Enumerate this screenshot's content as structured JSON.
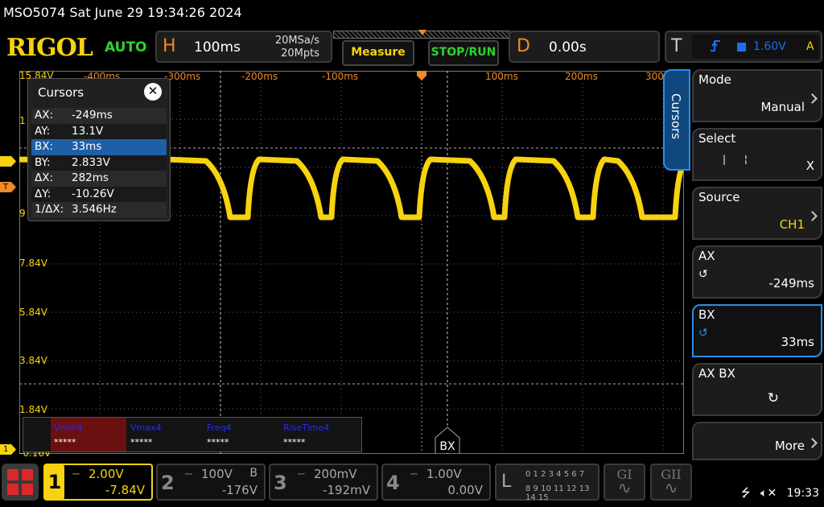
{
  "title_bar": {
    "text": "MSO5074  Sat June 29 19:34:26 2024"
  },
  "top": {
    "logo": "RIGOL",
    "trigger_status": "AUTO",
    "horizontal": {
      "letter": "H",
      "timebase": "100ms",
      "sample_rate": "20MSa/s",
      "memory_depth": "20Mpts"
    },
    "measure_label": "Measure",
    "stop_run_label": "STOP/RUN",
    "delay": {
      "letter": "D",
      "value": "0.00s"
    },
    "trigger": {
      "letter": "T",
      "level": "1.60V",
      "mode": "A",
      "edge_icon": "rising-edge-icon",
      "source_color": "#1e6ef0"
    }
  },
  "graticule": {
    "y_labels": [
      "15.84V",
      "1",
      "9",
      "7.84V",
      "5.84V",
      "3.84V",
      "1.84V",
      "-0.16V"
    ],
    "x_labels": [
      "-400ms",
      "-300ms",
      "-200ms",
      "-100ms",
      "100ms",
      "200ms",
      "300"
    ],
    "ch1_marker": "1",
    "trigger_marker": "T"
  },
  "cursors_dialog": {
    "title": "Cursors",
    "rows": [
      {
        "key": "AX:",
        "value": "-249ms"
      },
      {
        "key": "AY:",
        "value": "13.1V"
      },
      {
        "key": "BX:",
        "value": "33ms"
      },
      {
        "key": "BY:",
        "value": "2.833V"
      },
      {
        "key": "ΔX:",
        "value": "282ms"
      },
      {
        "key": "ΔY:",
        "value": "-10.26V"
      },
      {
        "key": "1/ΔX:",
        "value": "3.546Hz"
      }
    ]
  },
  "measurements": [
    {
      "name": "Vmin4",
      "value": "*****"
    },
    {
      "name": "Vmax4",
      "value": "*****"
    },
    {
      "name": "Freq4",
      "value": "*****"
    },
    {
      "name": "RiseTime4",
      "value": "*****"
    }
  ],
  "bx_tag": "BX",
  "side_menu": {
    "tab_label": "Cursors",
    "items": [
      {
        "title": "Mode",
        "value": "Manual"
      },
      {
        "title": "Select",
        "value": "X"
      },
      {
        "title": "Source",
        "value": "CH1"
      },
      {
        "title": "AX",
        "value": "-249ms"
      },
      {
        "title": "BX",
        "value": "33ms"
      },
      {
        "title": "AX BX",
        "value": "↻"
      },
      {
        "title": "",
        "value": "More"
      }
    ]
  },
  "channels": [
    {
      "num": "1",
      "scale": "2.00V",
      "offset": "-7.84V",
      "bw": ""
    },
    {
      "num": "2",
      "scale": "100V",
      "offset": "-176V",
      "bw": "B"
    },
    {
      "num": "3",
      "scale": "200mV",
      "offset": "-192mV",
      "bw": ""
    },
    {
      "num": "4",
      "scale": "1.00V",
      "offset": "0.00V",
      "bw": ""
    }
  ],
  "logic": {
    "letter": "L",
    "row1": "0 1 2 3  4 5 6 7",
    "row2": "8 9 10 11 12 13 14 15"
  },
  "generators": [
    {
      "label": "GI"
    },
    {
      "label": "GII"
    }
  ],
  "status": {
    "time": "19:33"
  },
  "colors": {
    "ch1": "#f6d30e",
    "accent_blue": "#2b8ee8",
    "delay_orange": "#f08a24",
    "run_green": "#2fd32f"
  }
}
